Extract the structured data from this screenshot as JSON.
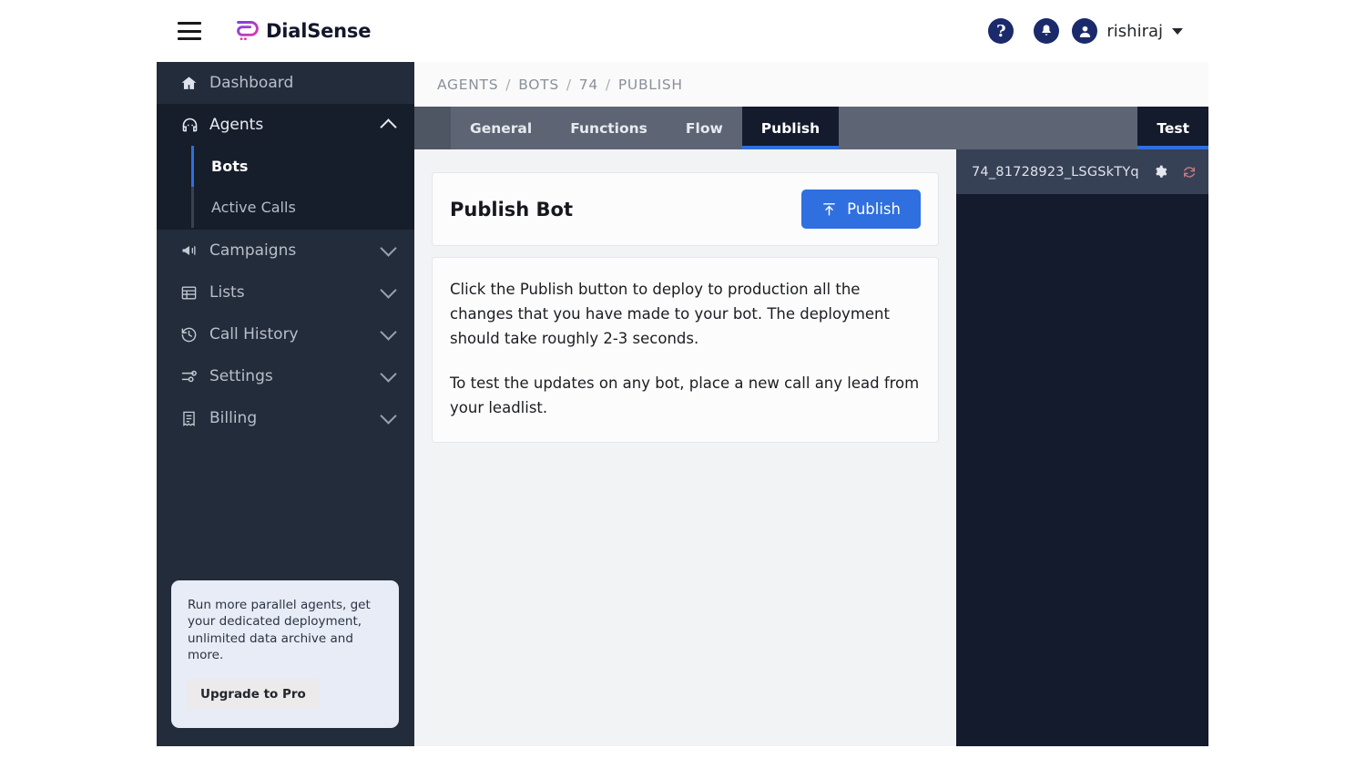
{
  "brand": {
    "name": "DialSense",
    "logo_icon": "dialsense-logo-icon"
  },
  "topbar": {
    "menu_icon": "hamburger-menu-icon",
    "help_icon": "help-circle-icon",
    "help_glyph": "?",
    "notifications_icon": "bell-icon",
    "avatar_icon": "user-avatar-icon",
    "user_name": "rishiraj",
    "caret_icon": "chevron-down-icon"
  },
  "sidebar": {
    "items": [
      {
        "label": "Dashboard",
        "icon": "home-icon",
        "expandable": false
      },
      {
        "label": "Agents",
        "icon": "agent-headset-icon",
        "expandable": true,
        "expanded": true
      },
      {
        "label": "Campaigns",
        "icon": "megaphone-icon",
        "expandable": true,
        "expanded": false
      },
      {
        "label": "Lists",
        "icon": "list-table-icon",
        "expandable": true,
        "expanded": false
      },
      {
        "label": "Call History",
        "icon": "history-clock-icon",
        "expandable": true,
        "expanded": false
      },
      {
        "label": "Settings",
        "icon": "sliders-icon",
        "expandable": true,
        "expanded": false
      },
      {
        "label": "Billing",
        "icon": "receipt-icon",
        "expandable": true,
        "expanded": false
      }
    ],
    "agents_subitems": [
      {
        "label": "Bots",
        "active": true
      },
      {
        "label": "Active Calls",
        "active": false
      }
    ],
    "upgrade": {
      "text": "Run more parallel agents, get your dedicated deployment, unlimited data archive and more.",
      "button_label": "Upgrade to Pro"
    }
  },
  "breadcrumb": {
    "items": [
      "AGENTS",
      "BOTS",
      "74",
      "PUBLISH"
    ],
    "separator": "/"
  },
  "tabs": {
    "items": [
      {
        "label": "General",
        "active": false
      },
      {
        "label": "Functions",
        "active": false
      },
      {
        "label": "Flow",
        "active": false
      },
      {
        "label": "Publish",
        "active": true
      }
    ],
    "right": {
      "label": "Test",
      "active": true
    }
  },
  "publish_card": {
    "title": "Publish Bot",
    "button_label": "Publish",
    "button_icon": "upload-icon",
    "paragraph_1": "Click the Publish button to deploy to production all the changes that you have made to your bot. The deployment should take roughly 2-3 seconds.",
    "paragraph_2": "To test the updates on any bot, place a new call any lead from your leadlist."
  },
  "test_panel": {
    "session_id": "74_81728923_LSGSkTYq",
    "settings_icon": "gear-icon",
    "reload_icon": "refresh-icon"
  },
  "colors": {
    "accent_blue": "#2f6fdf",
    "sidebar_bg": "#232c3b",
    "sidebar_active_bg": "#161d2b",
    "tabstrip_bg": "#5d6574",
    "tab_active_bg": "#141b2c",
    "content_bg": "#f2f3f5",
    "upgrade_card_bg": "#e7ecf7",
    "reload_icon_color": "#c97b82",
    "brand_purple": "#8b2fd4"
  }
}
